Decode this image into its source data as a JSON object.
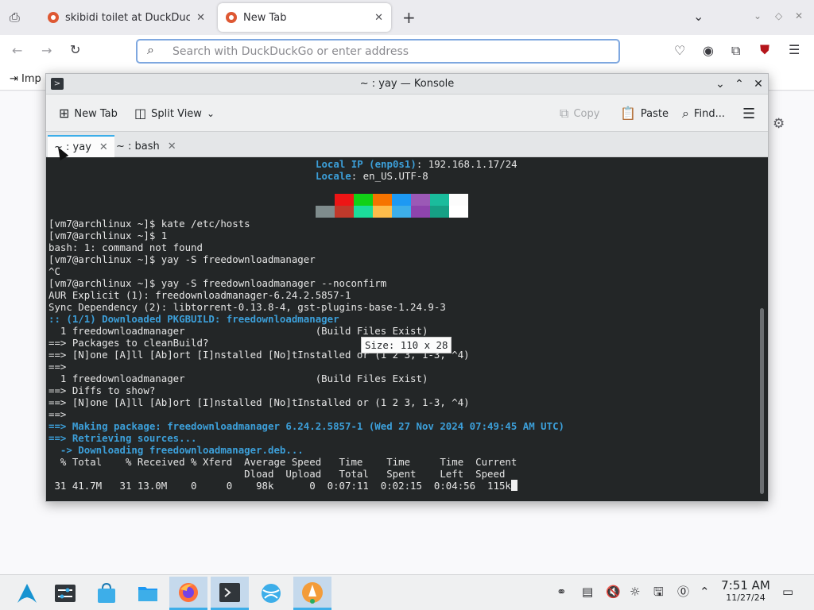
{
  "browser": {
    "tabs": [
      {
        "title": "skibidi toilet at DuckDuckGo",
        "active": false
      },
      {
        "title": "New Tab",
        "active": true
      }
    ],
    "new_tab_symbol": "+",
    "close_symbol": "✕",
    "url_placeholder": "Search with DuckDuckGo or enter address",
    "url_value": "",
    "bookmark_label": "Imp"
  },
  "konsole": {
    "title": "~ : yay — Konsole",
    "toolbar": {
      "new_tab": "New Tab",
      "split_view": "Split View",
      "copy": "Copy",
      "paste": "Paste",
      "find": "Find..."
    },
    "tabs": [
      {
        "label": "~ : yay",
        "active": true
      },
      {
        "label": "~ : bash",
        "active": false
      }
    ],
    "palette_top": [
      "#ed1515",
      "#11d116",
      "#f67400",
      "#1d99f3",
      "#9b59b6",
      "#1abc9c",
      "#fcfcfc"
    ],
    "palette_bottom": [
      "#7f8c8d",
      "#c0392b",
      "#1cdc9a",
      "#fdbc4b",
      "#3daee9",
      "#8e44ad",
      "#16a085",
      "#ffffff"
    ],
    "lines": {
      "l_ip_label": "Local IP (enp0s1)",
      "l_ip_value": ": 192.168.1.17/24",
      "l_locale_label": "Locale",
      "l_locale_value": ": en_US.UTF-8",
      "l1": "[vm7@archlinux ~]$ kate /etc/hosts",
      "l2": "[vm7@archlinux ~]$ 1",
      "l3": "bash: 1: command not found",
      "l4": "[vm7@archlinux ~]$ yay -S freedownloadmanager",
      "l5": "^C",
      "l6": "[vm7@archlinux ~]$ yay -S freedownloadmanager --noconfirm",
      "l7": "AUR Explicit (1): freedownloadmanager-6.24.2.5857-1",
      "l8": "Sync Dependency (2): libtorrent-0.13.8-4, gst-plugins-base-1.24.9-3",
      "l9": ":: (1/1) Downloaded PKGBUILD: freedownloadmanager",
      "l10": "  1 freedownloadmanager                      (Build Files Exist)",
      "l11": "==> Packages to cleanBuild?",
      "l12": "==> [N]one [A]ll [Ab]ort [I]nstalled [No]tInstalled or (1 2 3, 1-3, ^4)",
      "l13": "==>",
      "l14": "  1 freedownloadmanager                      (Build Files Exist)",
      "l15": "==> Diffs to show?",
      "l16": "==> [N]one [A]ll [Ab]ort [I]nstalled [No]tInstalled or (1 2 3, 1-3, ^4)",
      "l17": "==>",
      "l18": "==> Making package: freedownloadmanager 6.24.2.5857-1 (Wed 27 Nov 2024 07:49:45 AM UTC)",
      "l19": "==> Retrieving sources...",
      "l20": "  -> Downloading freedownloadmanager.deb...",
      "l21": "  % Total    % Received % Xferd  Average Speed   Time    Time     Time  Current",
      "l22": "                                 Dload  Upload   Total   Spent    Left  Speed",
      "l23": " 31 41.7M   31 13.0M    0     0    98k      0  0:07:11  0:02:15  0:04:56  115k"
    },
    "tooltip": "Size: 110 x 28"
  },
  "taskbar": {
    "time": "7:51 AM",
    "date": "11/27/24"
  }
}
